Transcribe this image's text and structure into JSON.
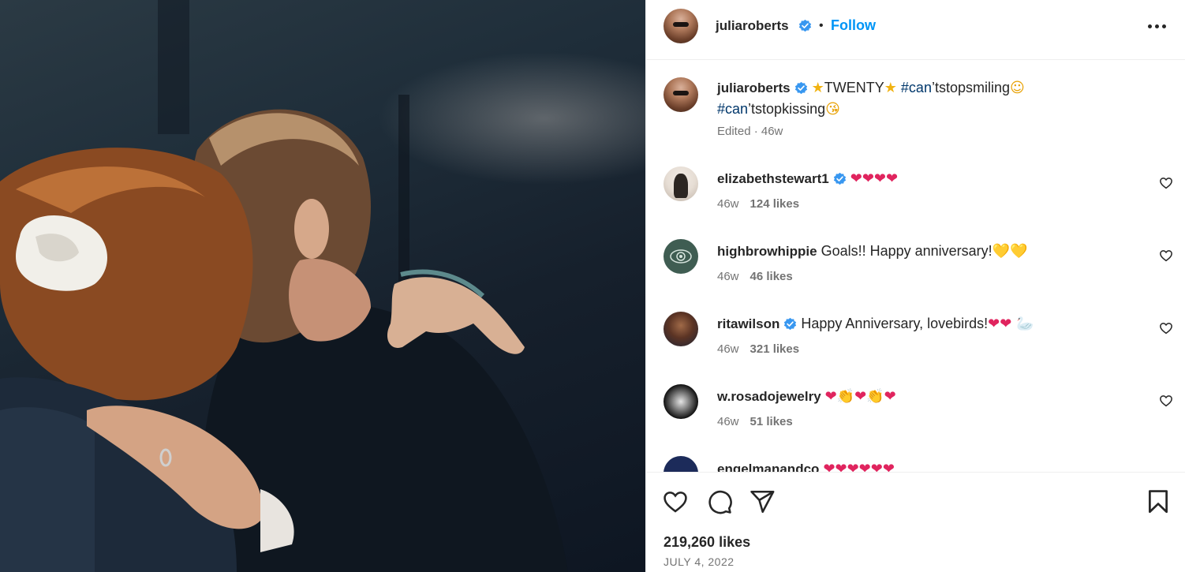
{
  "post": {
    "username": "juliaroberts",
    "follow_label": "Follow",
    "dot": "•",
    "caption": {
      "star_left": "★",
      "title": "TWENTY",
      "star_right": "★",
      "tag1": "#can",
      "tag1_rest": "’tstopsmiling",
      "emoji1": "☺",
      "tag2": "#can",
      "tag2_rest": "’tstopkissing",
      "emoji2": "😘"
    },
    "edited": "Edited · 46w"
  },
  "comments": [
    {
      "username": "elizabethstewart1",
      "verified": true,
      "text": "",
      "emojis": "❤❤❤❤",
      "time": "46w",
      "likes": "124 likes"
    },
    {
      "username": "highbrowhippie",
      "verified": false,
      "text": "Goals!! Happy anniversary!",
      "emojis": "💛💛",
      "time": "46w",
      "likes": "46 likes"
    },
    {
      "username": "ritawilson",
      "verified": true,
      "text": "Happy Anniversary, lovebirds!",
      "emojis": "❤❤ 🦢",
      "time": "46w",
      "likes": "321 likes"
    },
    {
      "username": "w.rosadojewelry",
      "verified": false,
      "text": "",
      "emojis": "❤👏❤👏❤",
      "time": "46w",
      "likes": "51 likes"
    },
    {
      "username": "engelmanandco",
      "verified": false,
      "text": "",
      "emojis": "❤❤❤❤❤❤",
      "time": "",
      "likes": ""
    }
  ],
  "footer": {
    "likes": "219,260 likes",
    "date": "JULY 4, 2022"
  },
  "colors": {
    "link_blue": "#0095f6",
    "hashtag": "#00376b",
    "verified_blue": "#3897f0",
    "heart_red": "#e0245e"
  },
  "icons": [
    "more-options-icon",
    "verified-badge-icon",
    "like-icon",
    "comment-icon",
    "share-icon",
    "save-icon",
    "comment-like-icon"
  ]
}
